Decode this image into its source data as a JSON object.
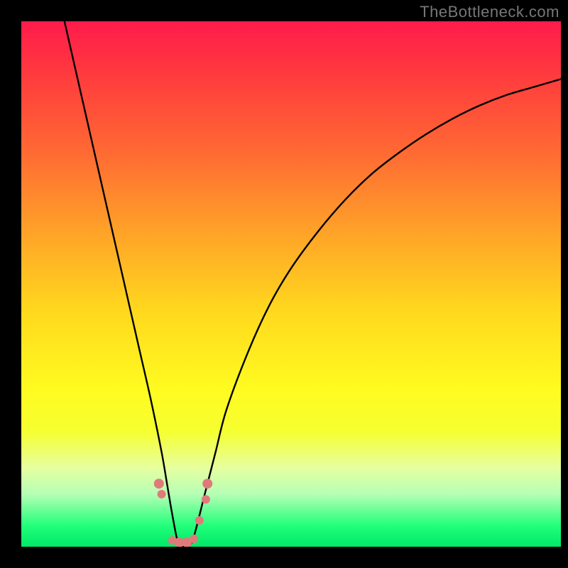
{
  "watermark": "TheBottleneck.com",
  "chart_data": {
    "type": "line",
    "title": "",
    "xlabel": "",
    "ylabel": "",
    "xlim": [
      0,
      100
    ],
    "ylim": [
      0,
      100
    ],
    "grid": false,
    "legend": false,
    "background": "rainbow-vertical-gradient",
    "series": [
      {
        "name": "bottleneck-curve",
        "color": "#000000",
        "x": [
          8,
          10,
          12,
          14,
          16,
          18,
          20,
          22,
          24,
          26,
          27,
          28,
          29,
          30,
          31,
          32,
          34,
          36,
          38,
          42,
          46,
          50,
          55,
          60,
          65,
          70,
          75,
          80,
          85,
          90,
          95,
          100
        ],
        "y": [
          100,
          91,
          82,
          73,
          64,
          55,
          46,
          37,
          28,
          18,
          12,
          6,
          1,
          0,
          0,
          2,
          10,
          18,
          26,
          37,
          46,
          53,
          60,
          66,
          71,
          75,
          78.5,
          81.5,
          84,
          86,
          87.5,
          89
        ]
      }
    ],
    "markers": [
      {
        "x": 25.5,
        "y": 12,
        "r": 7
      },
      {
        "x": 26.0,
        "y": 10,
        "r": 6
      },
      {
        "x": 28.0,
        "y": 1.2,
        "r": 6
      },
      {
        "x": 29.3,
        "y": 0.8,
        "r": 7
      },
      {
        "x": 30.7,
        "y": 0.8,
        "r": 7
      },
      {
        "x": 32.0,
        "y": 1.5,
        "r": 6
      },
      {
        "x": 33.0,
        "y": 5,
        "r": 6
      },
      {
        "x": 34.5,
        "y": 12,
        "r": 7
      },
      {
        "x": 34.2,
        "y": 9,
        "r": 6
      }
    ],
    "colors": {
      "gradient_top": "#ff1b4b",
      "gradient_mid": "#fffb20",
      "gradient_bottom": "#00e868",
      "curve": "#000000",
      "markers": "#e07a7a",
      "frame": "#000000"
    }
  }
}
